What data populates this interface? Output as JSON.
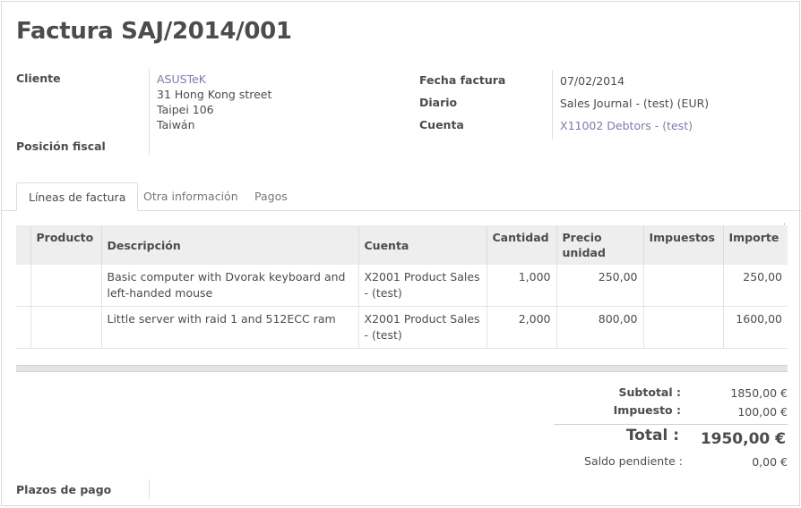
{
  "title": "Factura SAJ/2014/001",
  "customer": {
    "label": "Cliente",
    "name": "ASUSTeK",
    "street": "31 Hong Kong street",
    "city": "Taipei 106",
    "country": "Taiwán",
    "fiscal_position_label": "Posición fiscal",
    "fiscal_position_value": ""
  },
  "invoice": {
    "date_label": "Fecha factura",
    "date_value": "07/02/2014",
    "journal_label": "Diario",
    "journal_value": "Sales Journal - (test) (EUR)",
    "account_label": "Cuenta",
    "account_value": "X11002 Debtors - (test)"
  },
  "tabs": [
    {
      "label": "Líneas de factura",
      "active": true
    },
    {
      "label": "Otra información",
      "active": false
    },
    {
      "label": "Pagos",
      "active": false
    }
  ],
  "lines_table": {
    "headers": [
      "",
      "Producto",
      "Descripción",
      "Cuenta",
      "Cantidad",
      "Precio unidad",
      "Impuestos",
      "Importe"
    ],
    "rows": [
      {
        "product": "",
        "description": "Basic computer with Dvorak keyboard and left-handed mouse",
        "account": "X2001 Product Sales - (test)",
        "quantity": "1,000",
        "unit_price": "250,00",
        "taxes": "",
        "amount": "250,00"
      },
      {
        "product": "",
        "description": "Little server with raid 1 and 512ECC ram",
        "account": "X2001 Product Sales - (test)",
        "quantity": "2,000",
        "unit_price": "800,00",
        "taxes": "",
        "amount": "1600,00"
      }
    ]
  },
  "totals": {
    "subtotal_label": "Subtotal :",
    "subtotal_value": "1850,00 €",
    "tax_label": "Impuesto :",
    "tax_value": "100,00 €",
    "total_label": "Total :",
    "total_value": "1950,00 €",
    "residual_label": "Saldo pendiente :",
    "residual_value": "0,00 €"
  },
  "payment_term": {
    "label": "Plazos de pago",
    "value": ""
  }
}
